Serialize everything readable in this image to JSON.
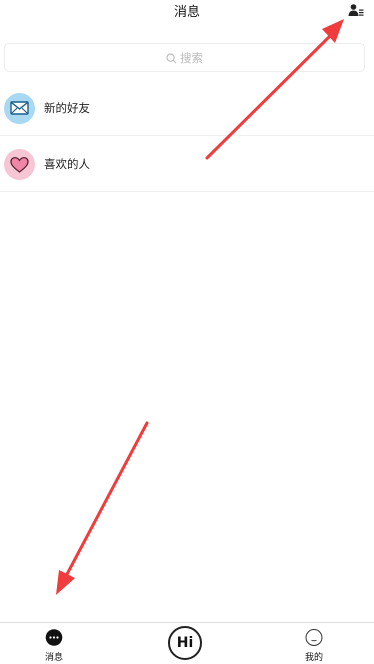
{
  "header": {
    "title": "消息",
    "contacts_icon": "contacts-list-icon"
  },
  "search": {
    "placeholder": "搜索",
    "icon": "search-icon"
  },
  "list": {
    "items": [
      {
        "label": "新的好友",
        "icon": "envelope-icon",
        "icon_bg": "#a9d8f2"
      },
      {
        "label": "喜欢的人",
        "icon": "heart-icon",
        "icon_bg": "#f6c6d4"
      }
    ]
  },
  "tabbar": {
    "tabs": [
      {
        "label": "消息",
        "icon": "chat-bubble-icon",
        "active": true
      },
      {
        "label": "Hi",
        "icon": "hi-button"
      },
      {
        "label": "我的",
        "icon": "profile-face-icon"
      }
    ]
  },
  "annotation_arrows": {
    "color": "#f03c3c",
    "count": 2
  }
}
